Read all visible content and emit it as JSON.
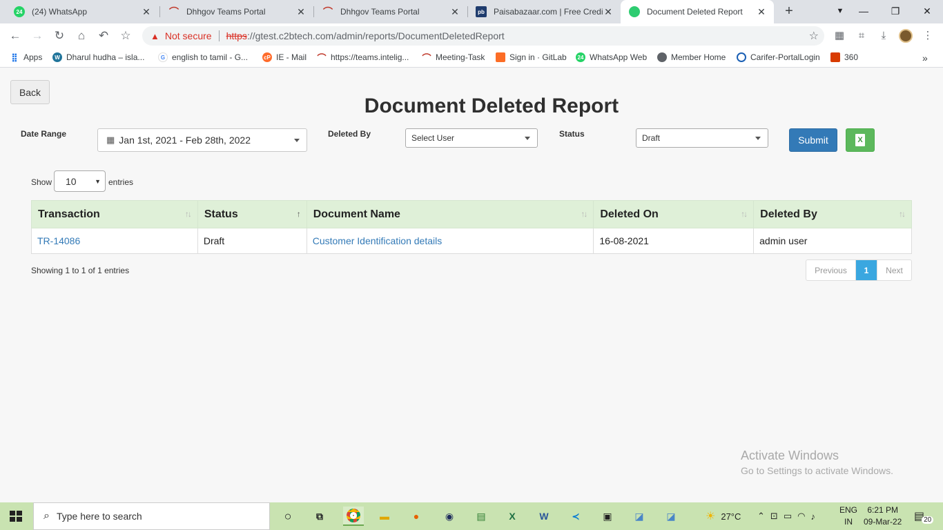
{
  "browser": {
    "tabs": [
      {
        "title": "(24) WhatsApp",
        "icon": "whatsapp-icon",
        "badge": "24"
      },
      {
        "title": "Dhhgov Teams Portal",
        "icon": "teams-portal-icon"
      },
      {
        "title": "Dhhgov Teams Portal",
        "icon": "teams-portal-icon"
      },
      {
        "title": "Paisabazaar.com | Free Credit",
        "icon": "paisabazaar-icon",
        "badge": "pb"
      },
      {
        "title": "Document Deleted Report",
        "icon": "page-icon",
        "active": true
      }
    ],
    "address": {
      "security": "Not secure",
      "scheme": "https",
      "rest": "://gtest.c2btech.com/admin/reports/DocumentDeletedReport"
    },
    "bookmarks": [
      {
        "label": "Apps",
        "icon": "apps-grid-icon"
      },
      {
        "label": "Dharul hudha – isla...",
        "icon": "wordpress-icon",
        "badge": "W"
      },
      {
        "label": "english to tamil - G...",
        "icon": "google-icon",
        "badge": "G"
      },
      {
        "label": "IE - Mail",
        "icon": "cpanel-icon",
        "badge": "cP"
      },
      {
        "label": "https://teams.intelig...",
        "icon": "teams-portal-icon"
      },
      {
        "label": "Meeting-Task",
        "icon": "teams-portal-icon"
      },
      {
        "label": "Sign in · GitLab",
        "icon": "gitlab-icon"
      },
      {
        "label": "WhatsApp Web",
        "icon": "whatsapp-icon",
        "badge": "24"
      },
      {
        "label": "Member Home",
        "icon": "globe-icon"
      },
      {
        "label": "Carifer-PortalLogin",
        "icon": "carifer-icon"
      },
      {
        "label": "360",
        "icon": "office-icon"
      }
    ]
  },
  "page": {
    "back_label": "Back",
    "title": "Document Deleted Report",
    "filters": {
      "date_range_label": "Date Range",
      "date_range_value": "Jan 1st, 2021 - Feb 28th, 2022",
      "deleted_by_label": "Deleted By",
      "deleted_by_value": "Select User",
      "status_label": "Status",
      "status_value": "Draft",
      "submit_label": "Submit",
      "excel_icon": "excel-export-icon"
    },
    "length": {
      "show": "Show",
      "value": "10",
      "entries": "entries"
    },
    "table": {
      "columns": [
        "Transaction",
        "Status",
        "Document Name",
        "Deleted On",
        "Deleted By"
      ],
      "rows": [
        {
          "transaction": "TR-14086",
          "status": "Draft",
          "document_name": "Customer Identification details",
          "deleted_on": "16-08-2021",
          "deleted_by": "admin user"
        }
      ]
    },
    "info": "Showing 1 to 1 of 1 entries",
    "pagination": {
      "previous": "Previous",
      "current": "1",
      "next": "Next"
    },
    "watermark": {
      "line1": "Activate Windows",
      "line2": "Go to Settings to activate Windows."
    }
  },
  "taskbar": {
    "search_placeholder": "Type here to search",
    "weather": "27°C",
    "lang_1": "ENG",
    "lang_2": "IN",
    "time": "6:21 PM",
    "date": "09-Mar-22",
    "notifications": "20",
    "accent": "#c9e3b1"
  }
}
